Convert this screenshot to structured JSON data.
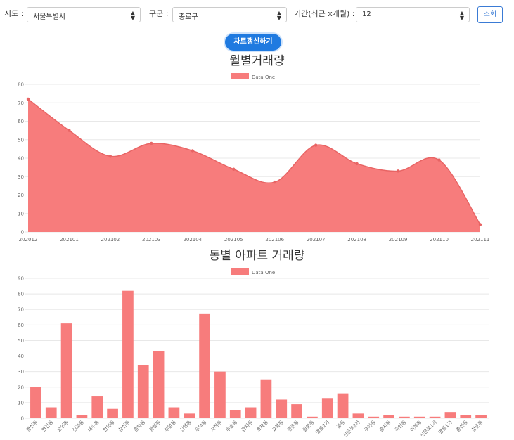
{
  "filters": {
    "sido_label": "시도 :",
    "sido_value": "서울특별시",
    "gugun_label": "구군 :",
    "gugun_value": "종로구",
    "period_label": "기간(최근 x개월) :",
    "period_value": "12",
    "search_label": "조회"
  },
  "refresh_label": "차트갱신하기",
  "colors": {
    "fill": "#f77c7c",
    "line": "#e86464",
    "accent": "#1f7ae0"
  },
  "chart_data": [
    {
      "type": "area",
      "title": "월별거래량",
      "legend": "Data One",
      "legend_position": "top",
      "x": [
        "202012",
        "202101",
        "202102",
        "202103",
        "202104",
        "202105",
        "202106",
        "202107",
        "202108",
        "202109",
        "202110",
        "202111"
      ],
      "values": [
        72,
        55,
        41,
        48,
        44,
        34,
        27,
        47,
        37,
        33,
        39,
        4
      ],
      "ylim": [
        0,
        80
      ],
      "yticks": [
        0,
        10,
        20,
        30,
        40,
        50,
        60,
        70,
        80
      ],
      "grid": true
    },
    {
      "type": "bar",
      "title": "동별 아파트 거래량",
      "legend": "Data One",
      "legend_position": "top",
      "categories": [
        "명신동",
        "연건동",
        "숭인동",
        "신교동",
        "내수동",
        "안의동",
        "창신동",
        "홍파동",
        "평창동",
        "부암동",
        "신영동",
        "무악동",
        "사직동",
        "수송동",
        "견지동",
        "효제동",
        "교북동",
        "행촌동",
        "필운동",
        "명륜2가",
        "궁동",
        "신문로2가",
        "구기동",
        "홍지동",
        "옥인동",
        "이화동",
        "신문로1가",
        "명륜1가",
        "충신동",
        "청운동"
      ],
      "values": [
        20,
        7,
        61,
        2,
        14,
        6,
        82,
        34,
        43,
        7,
        3,
        67,
        30,
        5,
        7,
        25,
        12,
        9,
        1,
        13,
        16,
        3,
        1,
        2,
        1,
        1,
        1,
        4,
        2,
        2
      ],
      "ylim": [
        0,
        90
      ],
      "yticks": [
        0,
        10,
        20,
        30,
        40,
        50,
        60,
        70,
        80,
        90
      ],
      "grid": true
    }
  ]
}
